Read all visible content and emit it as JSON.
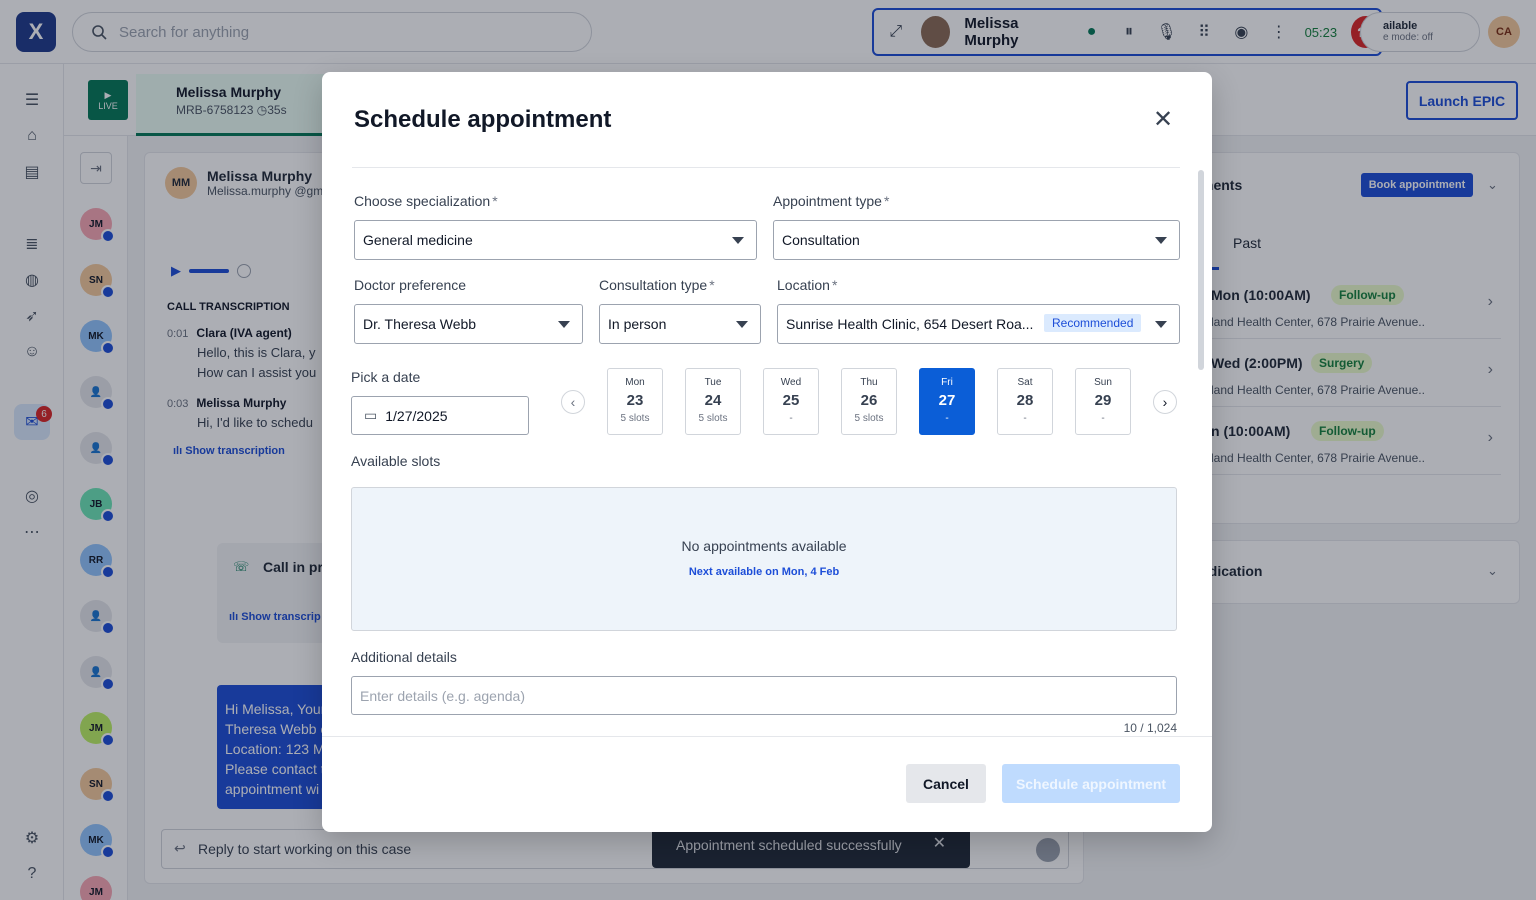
{
  "topbar": {
    "logo_text": "X",
    "search_placeholder": "Search for anything",
    "call": {
      "caller_name": "Melissa Murphy",
      "timer": "05:23"
    },
    "status": {
      "label": "ailable",
      "sub": "e mode: off"
    },
    "user_initials": "CA"
  },
  "leftnav": {
    "badge_count": "6"
  },
  "case": {
    "live_label": "LIVE",
    "name": "Melissa Murphy",
    "id": "MRB-6758123",
    "duration": "35s",
    "launch_label": "Launch EPIC"
  },
  "convlist": {
    "avatars": [
      "JM",
      "SN",
      "MK",
      "",
      "",
      "JB",
      "RR",
      "",
      "",
      "JM",
      "SN",
      "MK",
      "JM"
    ]
  },
  "chat": {
    "initials": "MM",
    "name": "Melissa Murphy",
    "email": "Melissa.murphy @gma",
    "transcription_label": "CALL TRANSCRIPTION",
    "line1": {
      "ts": "0:01",
      "speaker": "Clara (IVA agent)",
      "text1": "Hello, this is Clara, y",
      "text2": "How can I assist you"
    },
    "line2": {
      "ts": "0:03",
      "speaker": "Melissa Murphy",
      "text": "Hi, I'd like to schedu"
    },
    "show_transcription": "Show transcription",
    "show_transcription_2": "Show transcrip",
    "call_in_progress": "Call in pr",
    "sms_lines": [
      "Hi Melissa, Your",
      "Theresa Webb o",
      "Location: 123 M",
      "Please contact t",
      "appointment wi"
    ],
    "reply_placeholder": "Reply to start working on this case"
  },
  "right": {
    "appointments_title": "ments",
    "book_label": "Book appointment",
    "past_tab": "Past",
    "appointments": [
      {
        "when": "Mon (10:00AM)",
        "tag": "Follow-up",
        "where": "land Health Center, 678 Prairie Avenue.."
      },
      {
        "when": "Wed (2:00PM)",
        "tag": "Surgery",
        "where": "land Health Center, 678 Prairie Avenue.."
      },
      {
        "when": "n (10:00AM)",
        "tag": "Follow-up",
        "where": "land Health Center, 678 Prairie Avenue.."
      }
    ],
    "medication_title": "edication"
  },
  "toast": {
    "text": "Appointment scheduled successfully"
  },
  "modal": {
    "title": "Schedule appointment",
    "specialization": {
      "label": "Choose specialization",
      "value": "General medicine"
    },
    "appointment_type": {
      "label": "Appointment type",
      "value": "Consultation"
    },
    "doctor": {
      "label": "Doctor preference",
      "value": "Dr. Theresa Webb"
    },
    "consultation_type": {
      "label": "Consultation type",
      "value": "In person"
    },
    "location": {
      "label": "Location",
      "value": "Sunrise Health Clinic, 654 Desert Roa...",
      "badge": "Recommended"
    },
    "required_mark": "*",
    "date": {
      "label": "Pick a date",
      "value": "1/27/2025"
    },
    "days": [
      {
        "name": "Mon",
        "num": "23",
        "slots": "5 slots"
      },
      {
        "name": "Tue",
        "num": "24",
        "slots": "5 slots"
      },
      {
        "name": "Wed",
        "num": "25",
        "slots": "-"
      },
      {
        "name": "Thu",
        "num": "26",
        "slots": "5 slots"
      },
      {
        "name": "Fri",
        "num": "27",
        "slots": "-"
      },
      {
        "name": "Sat",
        "num": "28",
        "slots": "-"
      },
      {
        "name": "Sun",
        "num": "29",
        "slots": "-"
      }
    ],
    "selected_day": "27",
    "available_slots_label": "Available slots",
    "no_appointments": "No appointments available",
    "next_available": "Next available on Mon, 4 Feb",
    "additional_label": "Additional details",
    "additional_placeholder": "Enter details (e.g. agenda)",
    "char_count": "10 / 1,024",
    "cancel_label": "Cancel",
    "schedule_label": "Schedule appointment"
  },
  "colors": {
    "primary": "#1d4ed8",
    "selected_day": "#0b5ed7",
    "live": "#047857",
    "end_call": "#dc2626"
  }
}
